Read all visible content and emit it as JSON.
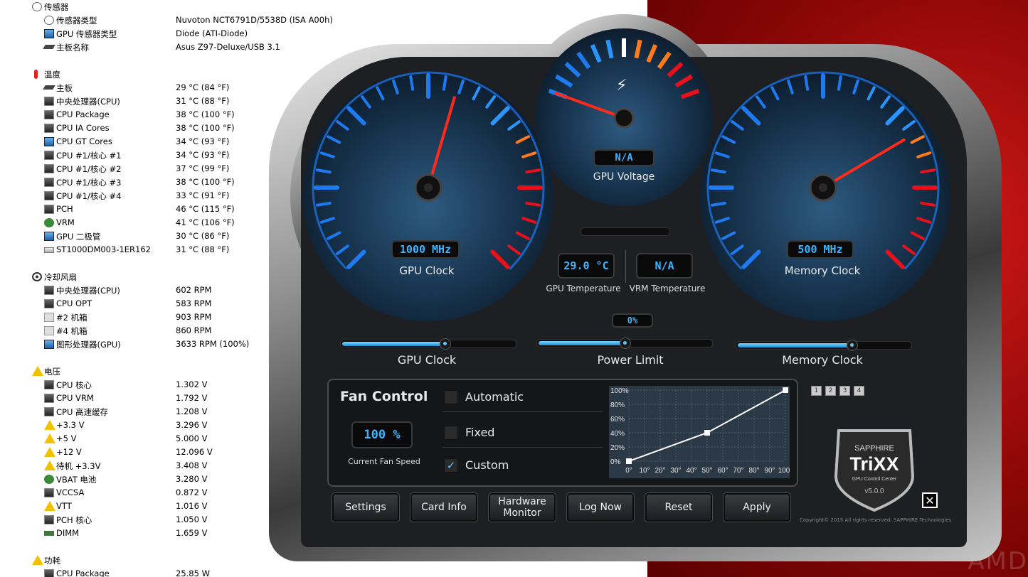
{
  "sensors": {
    "sections": [
      {
        "title": "传感器",
        "icon": "sensor-icon",
        "rows": [
          {
            "label": "传感器类型",
            "value": "Nuvoton NCT6791D/5538D  (ISA A00h)",
            "icon": "gauge-icon"
          },
          {
            "label": "GPU 传感器类型",
            "value": "Diode  (ATI-Diode)",
            "icon": "monitor-icon"
          },
          {
            "label": "主板名称",
            "value": "Asus Z97-Deluxe/USB 3.1",
            "icon": "motherboard-icon"
          }
        ]
      },
      {
        "title": "温度",
        "icon": "thermometer-icon",
        "rows": [
          {
            "label": "主板",
            "value": "29 °C  (84 °F)",
            "icon": "motherboard-icon"
          },
          {
            "label": "中央处理器(CPU)",
            "value": "31 °C  (88 °F)",
            "icon": "chip-icon"
          },
          {
            "label": "CPU Package",
            "value": "38 °C  (100 °F)",
            "icon": "chip-icon"
          },
          {
            "label": "CPU IA Cores",
            "value": "38 °C  (100 °F)",
            "icon": "chip-icon"
          },
          {
            "label": "CPU GT Cores",
            "value": "34 °C  (93 °F)",
            "icon": "monitor-icon"
          },
          {
            "label": "CPU #1/核心 #1",
            "value": "34 °C  (93 °F)",
            "icon": "chip-icon"
          },
          {
            "label": "CPU #1/核心 #2",
            "value": "37 °C  (99 °F)",
            "icon": "chip-icon"
          },
          {
            "label": "CPU #1/核心 #3",
            "value": "38 °C  (100 °F)",
            "icon": "chip-icon"
          },
          {
            "label": "CPU #1/核心 #4",
            "value": "33 °C  (91 °F)",
            "icon": "chip-icon"
          },
          {
            "label": "PCH",
            "value": "46 °C  (115 °F)",
            "icon": "chip-icon"
          },
          {
            "label": "VRM",
            "value": "41 °C  (106 °F)",
            "icon": "vrm-icon"
          },
          {
            "label": "GPU 二极管",
            "value": "30 °C  (86 °F)",
            "icon": "monitor-icon"
          },
          {
            "label": "ST1000DM003-1ER162",
            "value": "31 °C  (88 °F)",
            "icon": "hdd-icon"
          }
        ]
      },
      {
        "title": "冷却风扇",
        "icon": "fan-icon",
        "rows": [
          {
            "label": "中央处理器(CPU)",
            "value": "602 RPM",
            "icon": "chip-icon"
          },
          {
            "label": "CPU OPT",
            "value": "583 RPM",
            "icon": "chip-icon"
          },
          {
            "label": "#2 机箱",
            "value": "903 RPM",
            "icon": "case-icon"
          },
          {
            "label": "#4 机箱",
            "value": "860 RPM",
            "icon": "case-icon"
          },
          {
            "label": "图形处理器(GPU)",
            "value": "3633 RPM  (100%)",
            "icon": "monitor-icon"
          }
        ]
      },
      {
        "title": "电压",
        "icon": "warning-icon",
        "rows": [
          {
            "label": "CPU 核心",
            "value": "1.302 V",
            "icon": "chip-icon"
          },
          {
            "label": "CPU VRM",
            "value": "1.792 V",
            "icon": "chip-icon"
          },
          {
            "label": "CPU 高速缓存",
            "value": "1.208 V",
            "icon": "chip-icon"
          },
          {
            "label": "+3.3 V",
            "value": "3.296 V",
            "icon": "warning-icon"
          },
          {
            "label": "+5 V",
            "value": "5.000 V",
            "icon": "warning-icon"
          },
          {
            "label": "+12 V",
            "value": "12.096 V",
            "icon": "warning-icon"
          },
          {
            "label": "待机 +3.3V",
            "value": "3.408 V",
            "icon": "warning-icon"
          },
          {
            "label": "VBAT 电池",
            "value": "3.280 V",
            "icon": "vrm-icon"
          },
          {
            "label": "VCCSA",
            "value": "0.872 V",
            "icon": "chip-icon"
          },
          {
            "label": "VTT",
            "value": "1.016 V",
            "icon": "warning-icon"
          },
          {
            "label": "PCH 核心",
            "value": "1.050 V",
            "icon": "chip-icon"
          },
          {
            "label": "DIMM",
            "value": "1.659 V",
            "icon": "ram-icon"
          }
        ]
      },
      {
        "title": "功耗",
        "icon": "warning-icon",
        "rows": [
          {
            "label": "CPU Package",
            "value": "25.85 W",
            "icon": "chip-icon"
          }
        ]
      }
    ]
  },
  "trixx": {
    "gpu_clock": {
      "value": "1000 MHz",
      "label": "GPU Clock",
      "needle_fraction": 0.56
    },
    "voltage": {
      "value": "N/A",
      "label": "GPU Voltage",
      "needle_fraction": 0.0
    },
    "memory_clock": {
      "value": "500 MHz",
      "label": "Memory Clock",
      "needle_fraction": 0.72
    },
    "gpu_temp": {
      "value": "29.0 °C",
      "label": "GPU Temperature"
    },
    "vrm_temp": {
      "value": "N/A",
      "label": "VRM Temperature"
    },
    "power_limit_value": "0%",
    "sliders": [
      {
        "label": "GPU Clock",
        "fraction": 0.6
      },
      {
        "label": "Power Limit",
        "fraction": 0.5
      },
      {
        "label": "Memory Clock",
        "fraction": 0.67
      }
    ],
    "fan": {
      "title": "Fan Control",
      "speed": "100 %",
      "speed_label": "Current Fan Speed",
      "options": [
        {
          "label": "Automatic",
          "checked": false
        },
        {
          "label": "Fixed",
          "checked": false
        },
        {
          "label": "Custom",
          "checked": true
        }
      ],
      "check_glyph": "✓",
      "curve": {
        "y_ticks": [
          "100%",
          "80%",
          "60%",
          "40%",
          "20%",
          "0%"
        ],
        "x_ticks": [
          "0°",
          "10°",
          "20°",
          "30°",
          "40°",
          "50°",
          "60°",
          "70°",
          "80°",
          "90°",
          "100°"
        ],
        "points": [
          [
            0,
            0
          ],
          [
            50,
            40
          ],
          [
            100,
            100
          ]
        ]
      }
    },
    "profiles": [
      "1",
      "2",
      "3",
      "4"
    ],
    "buttons": [
      {
        "label": "Settings",
        "name": "settings-button"
      },
      {
        "label": "Card Info",
        "name": "card-info-button"
      },
      {
        "label": "Hardware Monitor",
        "name": "hardware-monitor-button"
      },
      {
        "label": "Log Now",
        "name": "log-now-button"
      },
      {
        "label": "Reset",
        "name": "reset-button"
      },
      {
        "label": "Apply",
        "name": "apply-button"
      }
    ],
    "badge": {
      "brand": "SAPPHIRE",
      "product": "TriXX",
      "subtitle": "GPU Control Center",
      "version": "v5.0.0"
    },
    "close_glyph": "✕",
    "copyright": "Copyright© 2015 All rights reserved. SAPPHIRE Technologies",
    "voltage_icon": "⚡"
  },
  "background": {
    "watermark": "AMD"
  }
}
